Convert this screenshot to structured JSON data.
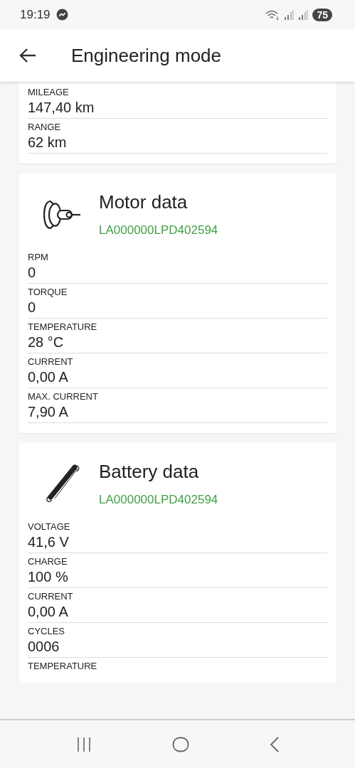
{
  "status_bar": {
    "time": "19:19",
    "battery": "75"
  },
  "app_bar": {
    "title": "Engineering mode"
  },
  "cards": [
    {
      "kind": "plain",
      "rows": [
        {
          "label": "MILEAGE",
          "value": "147,40 km"
        },
        {
          "label": "RANGE",
          "value": "62 km"
        }
      ]
    },
    {
      "kind": "motor",
      "title": "Motor data",
      "serial": "LA000000LPD402594",
      "rows": [
        {
          "label": "RPM",
          "value": "0"
        },
        {
          "label": "TORQUE",
          "value": "0"
        },
        {
          "label": "TEMPERATURE",
          "value": "28 °C"
        },
        {
          "label": "CURRENT",
          "value": "0,00 A"
        },
        {
          "label": "MAX. CURRENT",
          "value": "7,90 A"
        }
      ]
    },
    {
      "kind": "battery",
      "title": "Battery data",
      "serial": "LA000000LPD402594",
      "rows": [
        {
          "label": "VOLTAGE",
          "value": "41,6 V"
        },
        {
          "label": "CHARGE",
          "value": "100 %"
        },
        {
          "label": "CURRENT",
          "value": "0,00 A"
        },
        {
          "label": "CYCLES",
          "value": "0006"
        },
        {
          "label": "TEMPERATURE"
        }
      ]
    }
  ]
}
